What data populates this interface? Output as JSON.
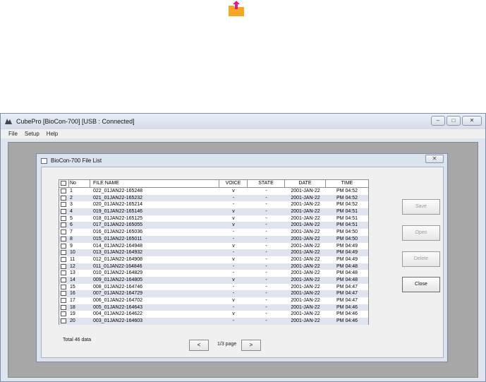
{
  "window": {
    "title": "CubePro [BioCon-700] [USB : Connected]",
    "controls": [
      "–",
      "□",
      "✕"
    ]
  },
  "menu": [
    "File",
    "Setup",
    "Help"
  ],
  "dialog": {
    "title": "BioCon-700 File List",
    "close": "✕"
  },
  "table": {
    "headers": [
      "",
      "No",
      "FILE NAME",
      "VOICE",
      "STATE",
      "DATE",
      "TIME"
    ],
    "rows": [
      [
        "1",
        "022_01JAN22-165248",
        "v",
        "-",
        "2001-JAN-22",
        "PM 04:52"
      ],
      [
        "2",
        "021_01JAN22-165232",
        "-",
        "-",
        "2001-JAN-22",
        "PM 04:52"
      ],
      [
        "3",
        "020_01JAN22-165214",
        "-",
        "-",
        "2001-JAN-22",
        "PM 04:52"
      ],
      [
        "4",
        "019_01JAN22-165146",
        "v",
        "-",
        "2001-JAN-22",
        "PM 04:51"
      ],
      [
        "5",
        "018_01JAN22-165125",
        "v",
        "-",
        "2001-JAN-22",
        "PM 04:51"
      ],
      [
        "6",
        "017_01JAN22-165055",
        "v",
        "-",
        "2001-JAN-22",
        "PM 04:51"
      ],
      [
        "7",
        "016_01JAN22-165036",
        "-",
        "-",
        "2001-JAN-22",
        "PM 04:50"
      ],
      [
        "8",
        "015_01JAN22-165011",
        "-",
        "-",
        "2001-JAN-22",
        "PM 04:50"
      ],
      [
        "9",
        "014_01JAN22-164948",
        "v",
        "-",
        "2001-JAN-22",
        "PM 04:49"
      ],
      [
        "10",
        "013_01JAN22-164932",
        "-",
        "-",
        "2001-JAN-22",
        "PM 04:49"
      ],
      [
        "11",
        "012_01JAN22-164908",
        "v",
        "-",
        "2001-JAN-22",
        "PM 04:49"
      ],
      [
        "12",
        "011_01JAN22-164846",
        "-",
        "-",
        "2001-JAN-22",
        "PM 04:48"
      ],
      [
        "13",
        "010_01JAN22-164829",
        "-",
        "-",
        "2001-JAN-22",
        "PM 04:48"
      ],
      [
        "14",
        "009_01JAN22-164805",
        "v",
        "-",
        "2001-JAN-22",
        "PM 04:48"
      ],
      [
        "15",
        "008_01JAN22-164746",
        "-",
        "-",
        "2001-JAN-22",
        "PM 04:47"
      ],
      [
        "16",
        "007_01JAN22-164729",
        "-",
        "-",
        "2001-JAN-22",
        "PM 04:47"
      ],
      [
        "17",
        "006_01JAN22-164702",
        "v",
        "-",
        "2001-JAN-22",
        "PM 04:47"
      ],
      [
        "18",
        "005_01JAN22-164643",
        "-",
        "-",
        "2001-JAN-22",
        "PM 04:46"
      ],
      [
        "19",
        "004_01JAN22-164622",
        "v",
        "-",
        "2001-JAN-22",
        "PM 04:46"
      ],
      [
        "20",
        "003_01JAN22-164603",
        "-",
        "-",
        "2001-JAN-22",
        "PM 04:46"
      ]
    ]
  },
  "footer": {
    "total": "Total 46 data",
    "prev": "<",
    "next": ">",
    "page": "1/3 page"
  },
  "buttons": {
    "save": "Save",
    "open": "Open",
    "delete": "Delete",
    "close": "Close"
  },
  "colors": {
    "folder": "#f5a623",
    "arrow": "#e8178a"
  }
}
